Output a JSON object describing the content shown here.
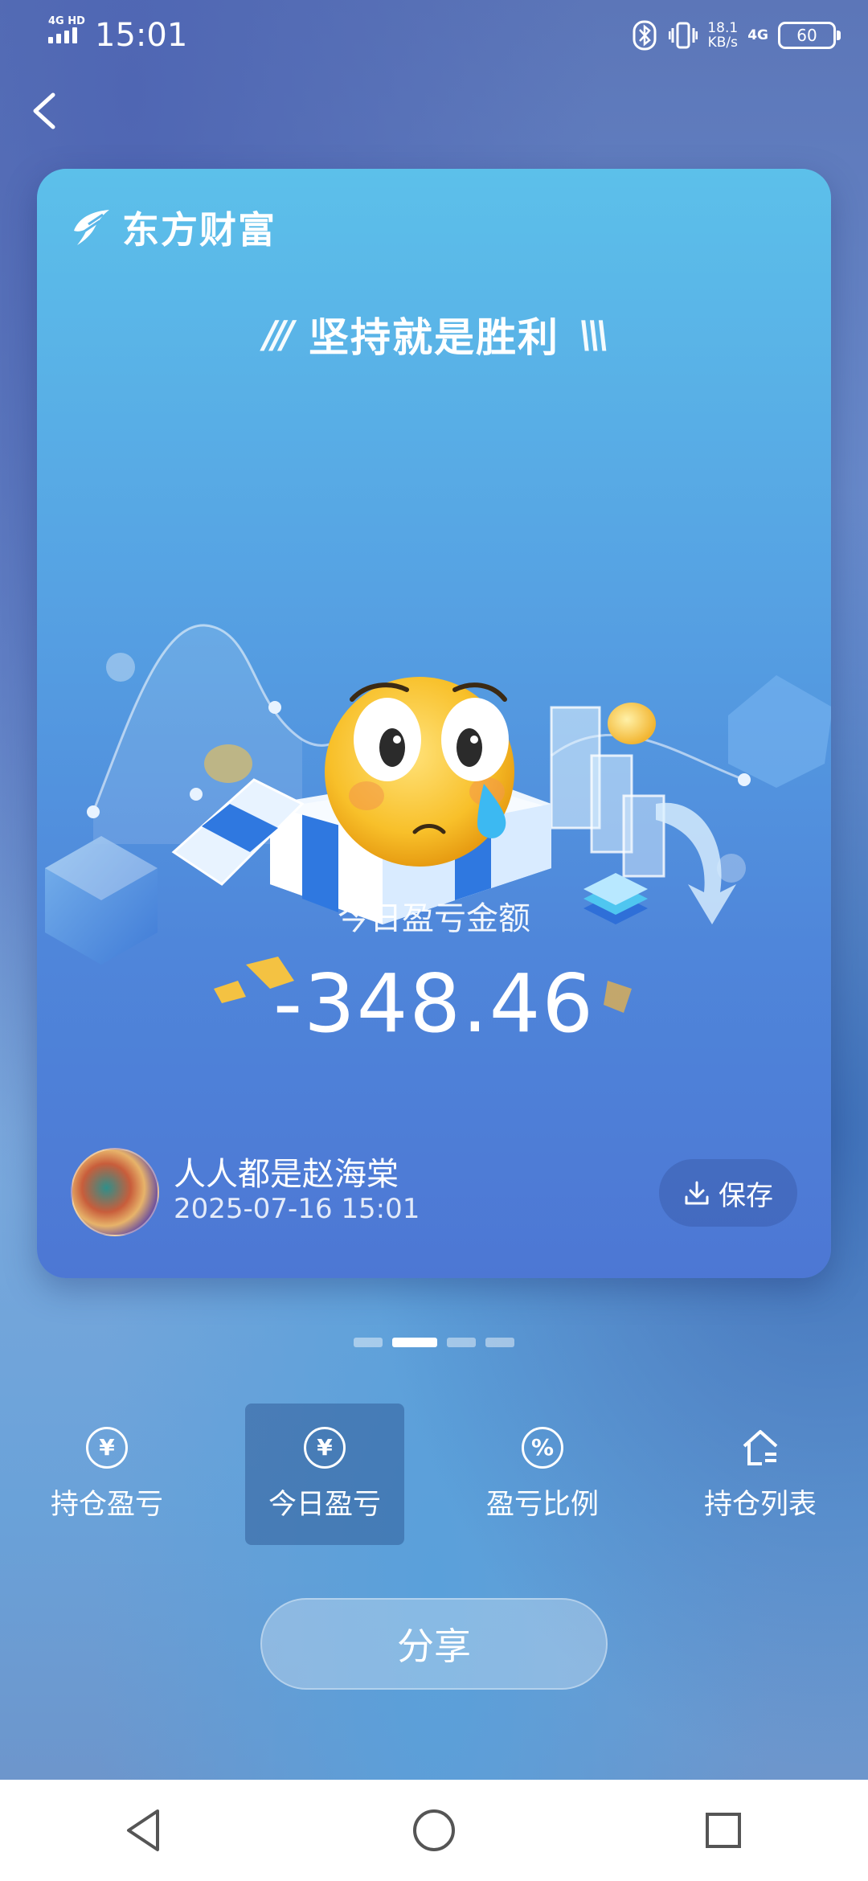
{
  "status_bar": {
    "network_type": "4G HD",
    "time": "15:01",
    "net_speed": "18.1",
    "net_speed_unit": "KB/s",
    "cell_type": "4G",
    "battery": "60"
  },
  "card": {
    "brand": "东方财富",
    "slogan": "坚持就是胜利",
    "amount_label": "今日盈亏金额",
    "amount": "-348.46",
    "username": "人人都是赵海棠",
    "datetime": "2025-07-16 15:01",
    "save_label": "保存"
  },
  "pager": {
    "total": 4,
    "active_index": 1
  },
  "tabs": [
    {
      "label": "持仓盈亏",
      "icon": "yuan-circle-icon",
      "glyph": "¥"
    },
    {
      "label": "今日盈亏",
      "icon": "yuan-circle-icon",
      "glyph": "¥"
    },
    {
      "label": "盈亏比例",
      "icon": "percent-circle-icon",
      "glyph": "%"
    },
    {
      "label": "持仓列表",
      "icon": "house-list-icon",
      "glyph": ""
    }
  ],
  "active_tab_index": 1,
  "share_label": "分享",
  "colors": {
    "card_top": "#5cc0ea",
    "card_bottom": "#4d77d4",
    "active_tab_bg": "#3a5f94",
    "share_button": "#ffffff"
  }
}
